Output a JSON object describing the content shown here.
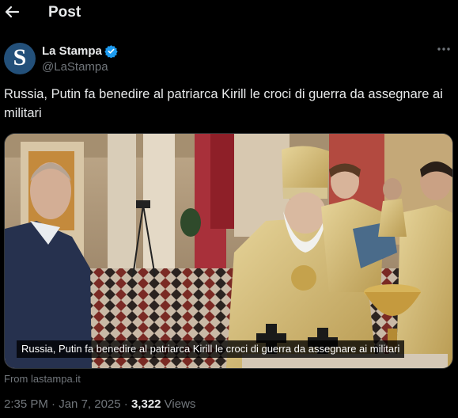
{
  "header": {
    "title": "Post"
  },
  "author": {
    "name": "La Stampa",
    "handle": "@LaStampa",
    "avatar_letter": "S"
  },
  "tweet": {
    "text": "Russia, Putin fa benedire al patriarca Kirill le croci di guerra da assegnare ai militari"
  },
  "media": {
    "caption": "Russia, Putin fa benedire al patriarca Kirill le croci di guerra da assegnare ai militari",
    "source": "From lastampa.it"
  },
  "meta": {
    "time": "2:35 PM",
    "separator1": " · ",
    "date": "Jan 7, 2025",
    "separator2": " · ",
    "views_count": "3,322",
    "views_label": " Views"
  },
  "colors": {
    "background": "#000000",
    "text": "#e7e9ea",
    "secondary": "#71767b",
    "verified": "#1d9bf0",
    "avatar_bg": "#23507a"
  },
  "icons": {
    "back": "arrow-left-icon",
    "verified": "verified-badge-icon",
    "more": "more-dots-icon"
  }
}
